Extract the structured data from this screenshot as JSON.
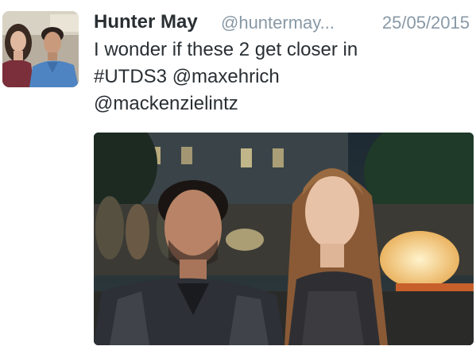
{
  "tweet": {
    "author_name": "Hunter May",
    "author_handle": "@huntermay...",
    "date": "25/05/2015",
    "text_lines": [
      "I wonder if these 2 get closer in",
      "#UTDS3 @maxehrich",
      "@mackenzielintz"
    ]
  },
  "icons": {
    "avatar": "profile-photo",
    "media": "attached-photo"
  },
  "colors": {
    "name": "#292f33",
    "meta": "#8899a6",
    "text": "#292f33"
  }
}
